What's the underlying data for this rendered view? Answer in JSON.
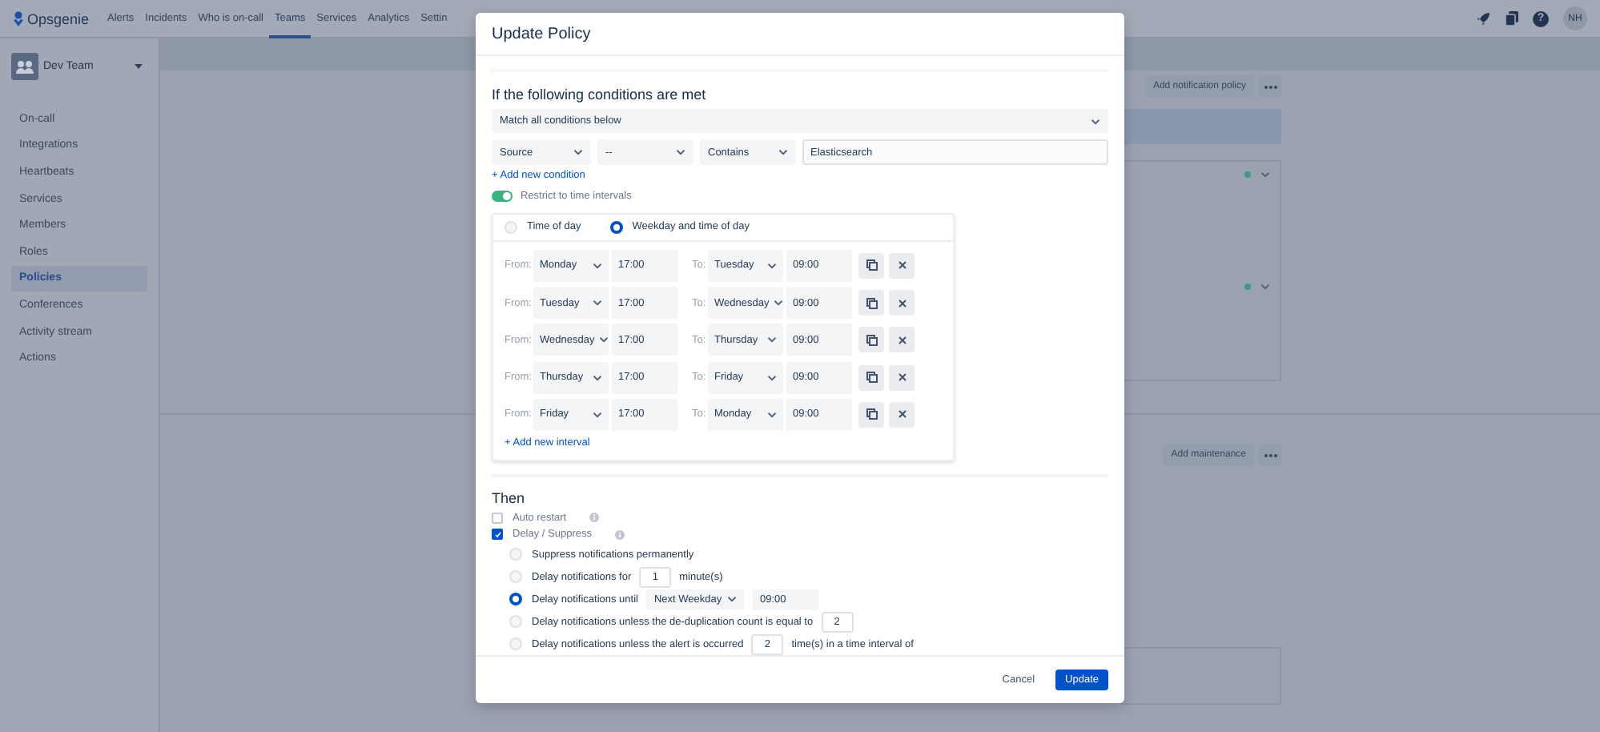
{
  "nav": {
    "logo": "Opsgenie",
    "items": [
      {
        "label": "Alerts",
        "selected": false
      },
      {
        "label": "Incidents",
        "selected": false
      },
      {
        "label": "Who is on-call",
        "selected": false
      },
      {
        "label": "Teams",
        "selected": true
      },
      {
        "label": "Services",
        "selected": false
      },
      {
        "label": "Analytics",
        "selected": false
      },
      {
        "label": "Settin",
        "selected": false
      }
    ],
    "help": "?",
    "avatar": "NH"
  },
  "sidebar": {
    "team": "Dev Team",
    "items": [
      {
        "label": "On-call",
        "selected": false
      },
      {
        "label": "Integrations",
        "selected": false
      },
      {
        "label": "Heartbeats",
        "selected": false
      },
      {
        "label": "Services",
        "selected": false
      },
      {
        "label": "Members",
        "selected": false
      },
      {
        "label": "Roles",
        "selected": false
      },
      {
        "label": "Policies",
        "selected": true
      },
      {
        "label": "Conferences",
        "selected": false
      },
      {
        "label": "Activity stream",
        "selected": false
      },
      {
        "label": "Actions",
        "selected": false
      }
    ]
  },
  "main": {
    "policy_button": "Add notification policy",
    "maintenance_button": "Add maintenance"
  },
  "dialog": {
    "title": "Update Policy",
    "conditions_heading": "If the following conditions are met",
    "match": "Match all conditions below",
    "condition": {
      "field": "Source",
      "operator_prefix": "--",
      "operator": "Contains",
      "value": "Elasticsearch"
    },
    "add_condition": "+ Add new condition",
    "restrict": {
      "label": "Restrict to time intervals",
      "on": true
    },
    "time_modes": [
      {
        "label": "Time of day",
        "selected": false
      },
      {
        "label": "Weekday and time of day",
        "selected": true
      }
    ],
    "intervals": [
      {
        "from_label": "From:",
        "from_day": "Monday",
        "from_time": "17:00",
        "to_label": "To:",
        "to_day": "Tuesday",
        "to_time": "09:00"
      },
      {
        "from_label": "From:",
        "from_day": "Tuesday",
        "from_time": "17:00",
        "to_label": "To:",
        "to_day": "Wednesday",
        "to_time": "09:00"
      },
      {
        "from_label": "From:",
        "from_day": "Wednesday",
        "from_time": "17:00",
        "to_label": "To:",
        "to_day": "Thursday",
        "to_time": "09:00"
      },
      {
        "from_label": "From:",
        "from_day": "Thursday",
        "from_time": "17:00",
        "to_label": "To:",
        "to_day": "Friday",
        "to_time": "09:00"
      },
      {
        "from_label": "From:",
        "from_day": "Friday",
        "from_time": "17:00",
        "to_label": "To:",
        "to_day": "Monday",
        "to_time": "09:00"
      }
    ],
    "add_interval": "+ Add new interval",
    "then_heading": "Then",
    "actions": [
      {
        "label": "Auto restart",
        "checked": false
      },
      {
        "label": "Delay / Suppress",
        "checked": true
      }
    ],
    "delay_options": [
      {
        "kind": "plain",
        "label": "Suppress notifications permanently",
        "selected": false
      },
      {
        "kind": "count",
        "label": "Delay notifications for",
        "value": "1",
        "suffix": "minute(s)",
        "selected": false
      },
      {
        "kind": "until",
        "label": "Delay notifications until",
        "day": "Next Weekday",
        "time": "09:00",
        "selected": true
      },
      {
        "kind": "count",
        "label": "Delay notifications unless the de-duplication count is equal to",
        "value": "2",
        "selected": false
      },
      {
        "kind": "count",
        "label": "Delay notifications unless the alert is occurred",
        "value": "2",
        "suffix": "time(s) in a time interval of",
        "selected": false
      }
    ],
    "cancel": "Cancel",
    "submit": "Update"
  }
}
